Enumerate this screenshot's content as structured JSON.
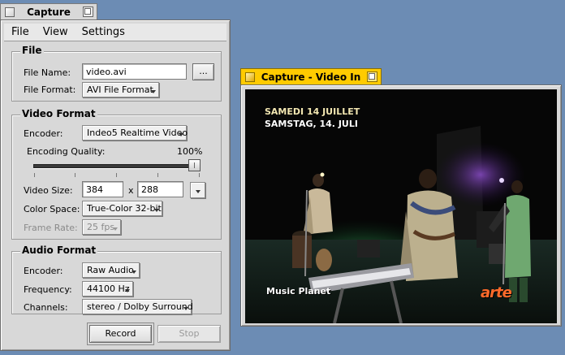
{
  "main_window": {
    "title": "Capture",
    "menu": [
      "File",
      "View",
      "Settings"
    ],
    "file_group": {
      "title": "File",
      "file_name_label": "File Name:",
      "file_name_value": "video.avi",
      "browse_label": "...",
      "file_format_label": "File Format:",
      "file_format_value": "AVI File Format"
    },
    "video_group": {
      "title": "Video Format",
      "encoder_label": "Encoder:",
      "encoder_value": "Indeo5 Realtime Video",
      "quality_label": "Encoding Quality:",
      "quality_value": "100%",
      "quality_fraction": 1.0,
      "video_size_label": "Video Size:",
      "width_value": "384",
      "size_separator": "x",
      "height_value": "288",
      "color_space_label": "Color Space:",
      "color_space_value": "True-Color 32-bit",
      "frame_rate_label": "Frame Rate:",
      "frame_rate_value": "25 fps"
    },
    "audio_group": {
      "title": "Audio Format",
      "encoder_label": "Encoder:",
      "encoder_value": "Raw Audio",
      "frequency_label": "Frequency:",
      "frequency_value": "44100 Hz",
      "channels_label": "Channels:",
      "channels_value": "stereo / Dolby Surround"
    },
    "buttons": {
      "record": "Record",
      "stop": "Stop"
    }
  },
  "video_window": {
    "title": "Capture - Video In",
    "overlay_line1": "SAMEDI 14 JUILLET",
    "overlay_line2": "SAMSTAG, 14. JULI",
    "overlay_bottom": "Music Planet",
    "logo_text": "arte"
  },
  "colors": {
    "desktop": "#6c8cb4",
    "active_tab": "#ffcb00",
    "window_bg": "#d8d8d8"
  }
}
